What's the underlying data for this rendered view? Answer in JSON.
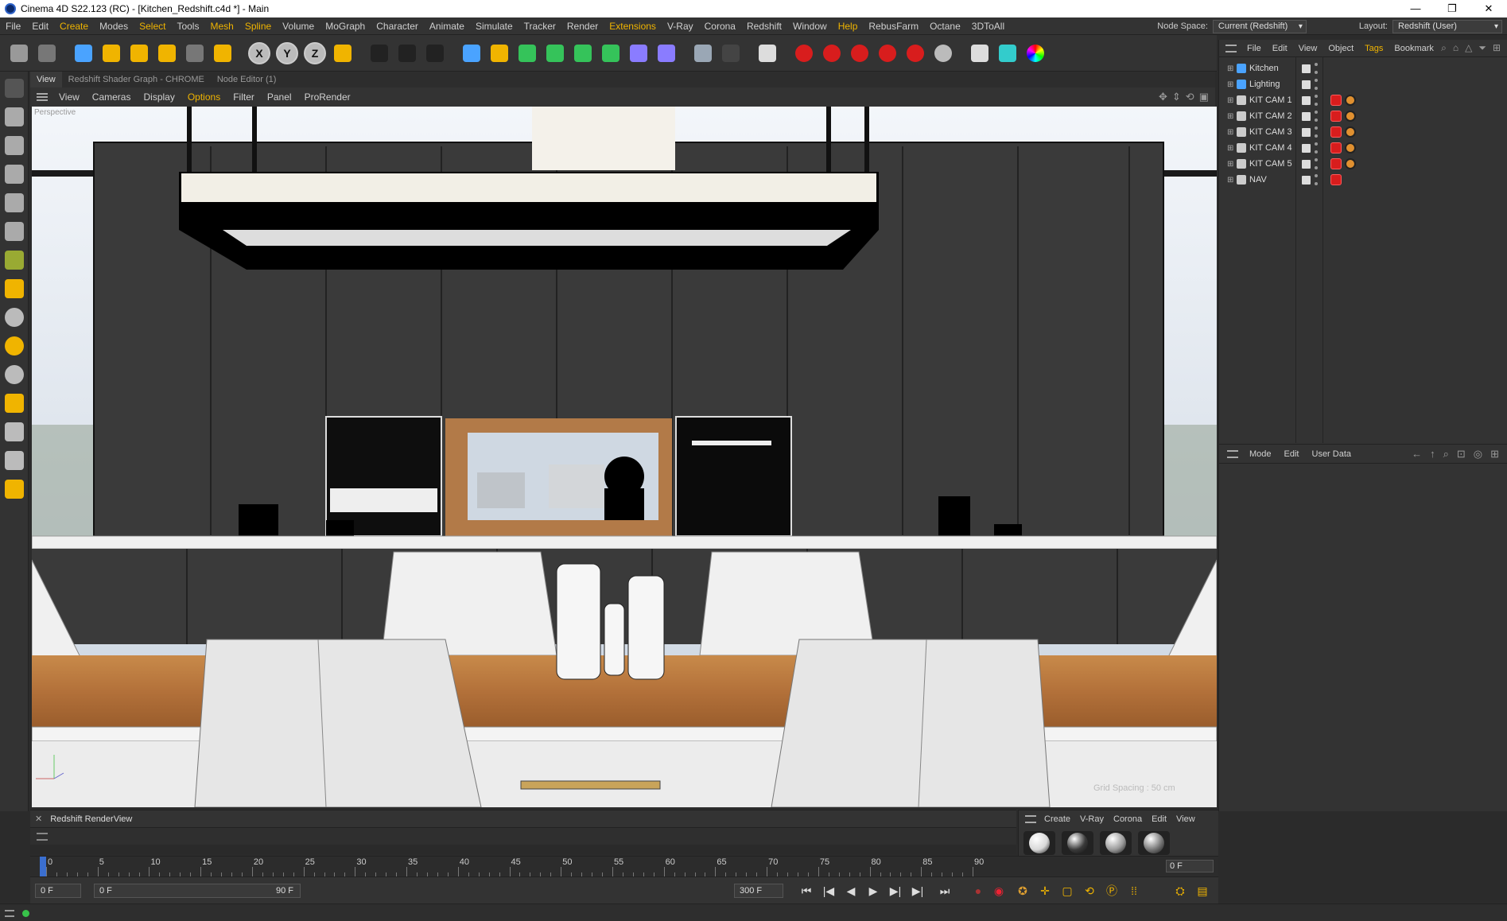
{
  "window": {
    "title": "Cinema 4D S22.123 (RC) - [Kitchen_Redshift.c4d *] - Main",
    "controls": [
      "—",
      "❐",
      "✕"
    ]
  },
  "menubar": {
    "items": [
      "File",
      "Edit",
      "Create",
      "Modes",
      "Select",
      "Tools",
      "Mesh",
      "Spline",
      "Volume",
      "MoGraph",
      "Character",
      "Animate",
      "Simulate",
      "Tracker",
      "Render",
      "Extensions",
      "V-Ray",
      "Corona",
      "Redshift",
      "Window",
      "Help",
      "RebusFarm",
      "Octane",
      "3DToAll"
    ],
    "highlighted": [
      "Create",
      "Select",
      "Mesh",
      "Spline",
      "Extensions",
      "Help"
    ],
    "node_space_label": "Node Space:",
    "node_space_value": "Current (Redshift)",
    "layout_label": "Layout:",
    "layout_value": "Redshift (User)"
  },
  "toolbar": {
    "axis_x": "X",
    "axis_y": "Y",
    "axis_z": "Z",
    "tools": [
      "undo-icon",
      "redo-icon",
      "live-selection-icon",
      "move-icon",
      "scale-icon",
      "rotate-icon",
      "recent-tools-icon",
      "select-tool-icon",
      "axis-x-icon",
      "axis-y-icon",
      "axis-z-icon",
      "coordinate-system-icon",
      "render-region-icon",
      "render-view-icon",
      "render-settings-icon",
      "cube-icon",
      "pen-icon",
      "subdivision-icon",
      "extrude-icon",
      "cloner-icon",
      "mograph-icon",
      "deformer-icon",
      "field-icon",
      "floor-icon",
      "camera-icon",
      "light-icon",
      "redshift-rv-icon",
      "redshift-ipr-icon",
      "redshift-material-icon",
      "redshift-object-icon",
      "redshift-proxy-icon",
      "redshift-export-icon",
      "search-tool-icon",
      "palette-icon",
      "color-wheel-icon"
    ]
  },
  "viewport_header": {
    "tabs": [
      "View",
      "Redshift Shader Graph - CHROME",
      "Node Editor (1)"
    ],
    "menu": [
      "View",
      "Cameras",
      "Display",
      "Options",
      "Filter",
      "Panel",
      "ProRender"
    ],
    "highlighted": [
      "Options"
    ],
    "camera_label": "Perspective",
    "grid_spacing_text": "Grid Spacing : 50 cm"
  },
  "object_manager": {
    "menu": [
      "File",
      "Edit",
      "View",
      "Object",
      "Tags",
      "Bookmark"
    ],
    "highlighted": [
      "Tags"
    ],
    "objects": [
      {
        "name": "Kitchen",
        "type": "layer",
        "tags": []
      },
      {
        "name": "Lighting",
        "type": "layer",
        "tags": []
      },
      {
        "name": "KIT CAM 1",
        "type": "camera",
        "tags": [
          "redshift",
          "protection"
        ]
      },
      {
        "name": "KIT CAM 2",
        "type": "camera",
        "tags": [
          "redshift",
          "protection"
        ]
      },
      {
        "name": "KIT CAM 3",
        "type": "camera",
        "tags": [
          "redshift",
          "protection"
        ]
      },
      {
        "name": "KIT CAM 4",
        "type": "camera",
        "tags": [
          "redshift",
          "protection"
        ]
      },
      {
        "name": "KIT CAM 5",
        "type": "camera",
        "tags": [
          "redshift",
          "protection"
        ]
      },
      {
        "name": "NAV",
        "type": "camera",
        "tags": [
          "redshift"
        ]
      }
    ]
  },
  "attribute_manager": {
    "menu": [
      "Mode",
      "Edit",
      "User Data"
    ]
  },
  "render_view": {
    "title": "Redshift RenderView"
  },
  "material_manager": {
    "menu": [
      "Create",
      "V-Ray",
      "Corona",
      "Edit",
      "View"
    ],
    "materials": [
      "#d8d8d8",
      "#3a3a3a",
      "#9a9a9a",
      "#777777"
    ]
  },
  "timeline": {
    "ticks": [
      "0",
      "5",
      "10",
      "15",
      "20",
      "25",
      "30",
      "35",
      "40",
      "45",
      "50",
      "55",
      "60",
      "65",
      "70",
      "75",
      "80",
      "85",
      "90"
    ],
    "current_frame": "0 F"
  },
  "transport": {
    "start_frame": "0 F",
    "range_start": "0 F",
    "range_end": "90 F",
    "end_frame": "300 F"
  },
  "colors": {
    "accent": "#f0b400",
    "panel": "#333333",
    "tag_red": "#d81d1d"
  }
}
